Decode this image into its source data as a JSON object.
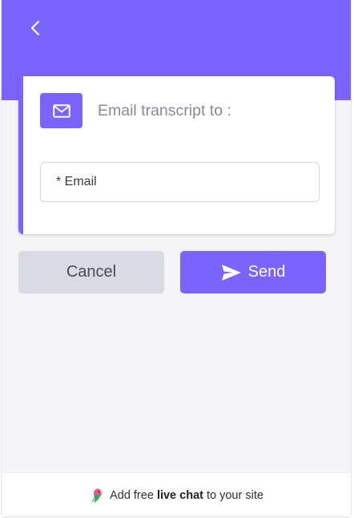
{
  "header": {
    "back_icon": "chevron-left-icon"
  },
  "card": {
    "icon": "mail-icon",
    "title": "Email transcript to :",
    "email_placeholder": "* Email",
    "email_value": ""
  },
  "actions": {
    "cancel_label": "Cancel",
    "send_label": "Send",
    "send_icon": "paper-plane-icon"
  },
  "footer": {
    "logo_icon": "parrot-logo-icon",
    "text_before": "Add free ",
    "text_bold": "live chat",
    "text_after": " to your site"
  },
  "colors": {
    "accent": "#7b63ff",
    "background": "#f5f5f7",
    "cancel_bg": "#d9dae3"
  }
}
